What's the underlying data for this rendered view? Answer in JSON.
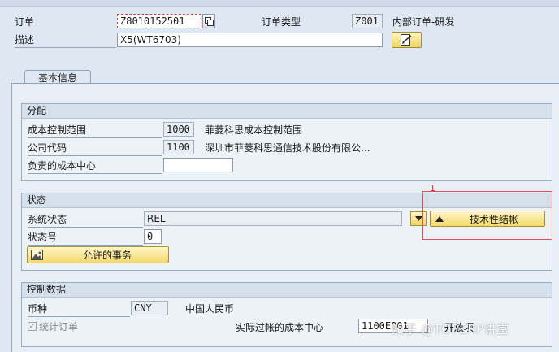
{
  "header": {
    "order_label": "订单",
    "order_value": "Z8010152501",
    "order_type_label": "订单类型",
    "order_type_value": "Z001",
    "order_type_desc": "内部订单-研发",
    "desc_label": "描述",
    "desc_value": "X5(WT6703)"
  },
  "tabs": [
    {
      "label": "基本信息",
      "active": true
    }
  ],
  "assignment": {
    "title": "分配",
    "rows": [
      {
        "label": "成本控制范围",
        "value": "1000",
        "desc": "菲菱科思成本控制范围"
      },
      {
        "label": "公司代码",
        "value": "1100",
        "desc": "深圳市菲菱科思通信技术股份有限公..."
      },
      {
        "label": "负责的成本中心",
        "value": "",
        "desc": ""
      }
    ]
  },
  "status": {
    "title": "状态",
    "system_status_label": "系统状态",
    "system_status_value": "REL",
    "status_no_label": "状态号",
    "status_no_value": "0",
    "allowed_tx_button": "允许的事务",
    "teco_button": "技术性结帐"
  },
  "control": {
    "title": "控制数据",
    "currency_label": "币种",
    "currency_value": "CNY",
    "currency_desc": "中国人民币",
    "stat_order_label": "统计订单",
    "stat_order_checked": true,
    "actual_cc_label": "实际过帐的成本中心",
    "actual_cc_value": "1100E001",
    "partial_label": "开放项"
  },
  "annotation": {
    "number": "1"
  },
  "watermark": "知乎 @TOPERP讲堂",
  "colors": {
    "accent_yellow": "#f3d96a",
    "annotation_red": "#e05050",
    "panel_bg": "#edf2f7",
    "group_header": "#d6e0eb"
  }
}
